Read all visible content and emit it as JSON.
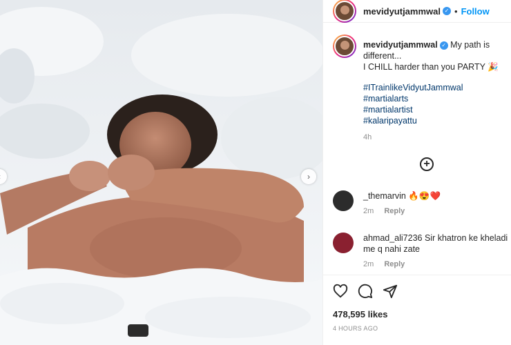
{
  "post": {
    "username": "mevidyutjammwal",
    "follow_label": "Follow",
    "separator": "•",
    "caption_line1": "My path is different...",
    "caption_line2": "I CHILL harder than you PARTY",
    "hashtags": [
      "#ITrainlikeVidyutJammwal",
      "#martialarts",
      "#martialartist",
      "#kalaripayattu"
    ],
    "age_short": "4h",
    "likes": "478,595 likes",
    "age_long": "4 HOURS AGO"
  },
  "comments": [
    {
      "user": "_themarvin",
      "text": "🔥😍❤️",
      "age": "2m",
      "reply": "Reply"
    },
    {
      "user": "ahmad_ali7236",
      "text": "Sir khatron ke kheladi me q nahi zate",
      "age": "2m",
      "reply": "Reply"
    }
  ],
  "icons": {
    "verified": "verified-badge-icon",
    "add_comment": "plus-circle-icon",
    "like": "heart-icon",
    "comment": "comment-bubble-icon",
    "share": "paper-plane-icon",
    "next": "chevron-right-icon",
    "prev": "chevron-left-icon"
  },
  "colors": {
    "link": "#0095f6",
    "hashtag": "#00376b",
    "muted": "#8e8e8e"
  }
}
